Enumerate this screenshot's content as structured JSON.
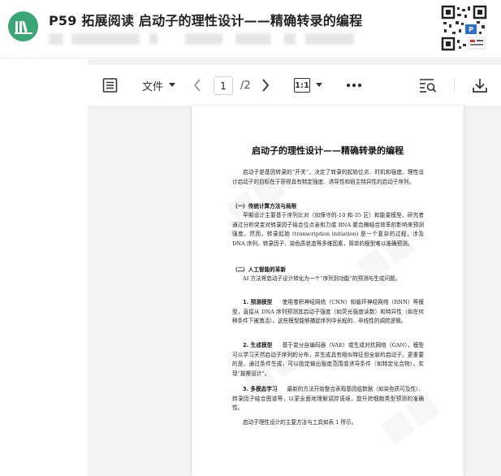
{
  "header": {
    "title": "P59 拓展阅读 启动子的理性设计——精确转录的编程"
  },
  "toolbar": {
    "file_label": "文件",
    "current_page": "1",
    "total_pages": "/2",
    "zoom_label": "1:1"
  },
  "document": {
    "title": "启动子的理性设计——精确转录的编程",
    "intro": "启动子是基因转录的“开关”，决定了转录的起始位点、时机和强度。理性设计启动子的目标在于获得具有特定强度、诱导性和宿主特异性的启动子序列。",
    "section1_heading": "（一）传统计算方法与局限",
    "section1_body": "早期设计主要基于序列比对（如保守的-10 和-35 区）和能量模型、研究者通过分析突变对转录因子结合位点亲和力或 RNA 聚合酶结合效率的影响来预测强度。然而，转录起始 (transcription initiation) 是一个复杂的过程，涉及 DNA 序列、转录因子、染色质状态等多维因素，简单的模型难以准确预测。",
    "section2_heading": "（二）人工智能的革新",
    "section2_body": "AI 方法将启动子设计转化为一个“序列到功能”的预测与生成问题。",
    "item1_label": "1. 预测模型",
    "item1_body": "使用卷积神经网络（CNN）和循环神经网络（RNN）等模型，直接从 DNA 序列预测其启动子强度（如荧光强度读数）和特异性（如在何种条件下被激活）。这些模型能够捕捉序列中长程的、非线性的调控逻辑。",
    "item2_label": "2. 生成模型",
    "item2_body": "基于变分自编码器（VAE）或生成对抗网络（GAN），模型可以学习天然启动子序列的分布，并生成具有相似特征但全新的启动子。更重要的是，通过条件生成，可以指定输出强度范围或诱导条件（如特定化合物），实现“按需设计”。",
    "item3_label": "3. 多模态学习",
    "item3_body": "最新的方法开始整合表观基因组数据（如染色质可及性）、转录因子结合图谱等，以更全面地理解调控语境，提升跨细胞类型预测的准确性。",
    "closing": "启动子理性设计的主要方法与工具如表 1 所示。"
  }
}
